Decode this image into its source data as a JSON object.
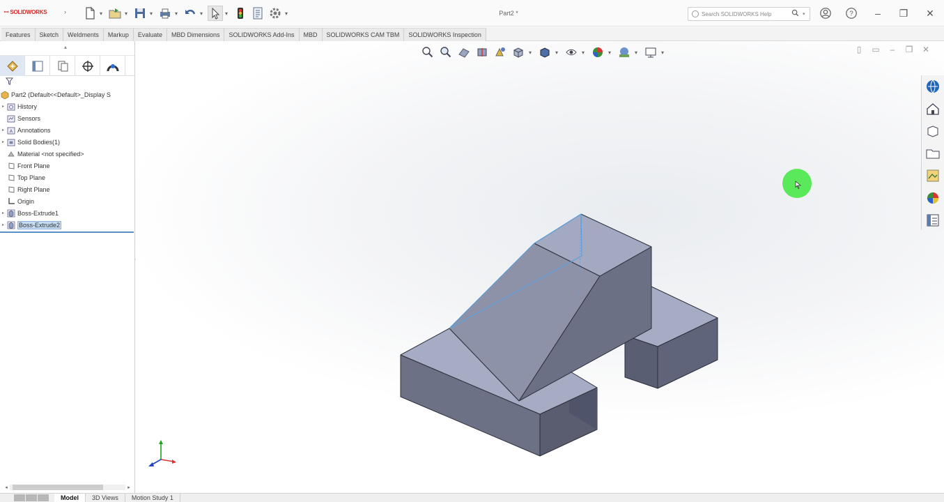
{
  "app": {
    "logo_text": "SOLIDWORKS",
    "document_title": "Part2 *"
  },
  "quick_access": [
    {
      "name": "new-document-icon"
    },
    {
      "name": "open-document-icon"
    },
    {
      "name": "save-icon"
    },
    {
      "name": "print-icon"
    },
    {
      "name": "undo-icon"
    },
    {
      "name": "select-icon"
    },
    {
      "name": "rebuild-icon"
    },
    {
      "name": "file-properties-icon"
    },
    {
      "name": "options-gear-icon"
    }
  ],
  "search": {
    "placeholder": "Search SOLIDWORKS Help"
  },
  "command_tabs": [
    "Features",
    "Sketch",
    "Weldments",
    "Markup",
    "Evaluate",
    "MBD Dimensions",
    "SOLIDWORKS Add-Ins",
    "MBD",
    "SOLIDWORKS CAM TBM",
    "SOLIDWORKS Inspection"
  ],
  "feature_tree": {
    "root": "Part2  (Default<<Default>_Display S",
    "items": [
      {
        "label": "History",
        "icon": "history-folder-icon",
        "expandable": true
      },
      {
        "label": "Sensors",
        "icon": "sensors-folder-icon",
        "expandable": false
      },
      {
        "label": "Annotations",
        "icon": "annotations-folder-icon",
        "expandable": true
      },
      {
        "label": "Solid Bodies(1)",
        "icon": "solid-bodies-folder-icon",
        "expandable": true
      },
      {
        "label": "Material <not specified>",
        "icon": "material-icon",
        "expandable": false
      },
      {
        "label": "Front Plane",
        "icon": "plane-icon",
        "expandable": false
      },
      {
        "label": "Top Plane",
        "icon": "plane-icon",
        "expandable": false
      },
      {
        "label": "Right Plane",
        "icon": "plane-icon",
        "expandable": false
      },
      {
        "label": "Origin",
        "icon": "origin-icon",
        "expandable": false
      },
      {
        "label": "Boss-Extrude1",
        "icon": "extrude-icon",
        "expandable": true
      },
      {
        "label": "Boss-Extrude2",
        "icon": "extrude-icon",
        "expandable": true,
        "selected": true
      }
    ]
  },
  "bottom_tabs": [
    "Model",
    "3D Views",
    "Motion Study 1"
  ],
  "active_bottom_tab": "Model",
  "colors": {
    "accent": "#5c8fc8",
    "model_face_top": "#a9aec6",
    "model_face_side": "#6f7386",
    "model_face_front": "#7c8196",
    "cursor_highlight": "#3fe83f"
  }
}
